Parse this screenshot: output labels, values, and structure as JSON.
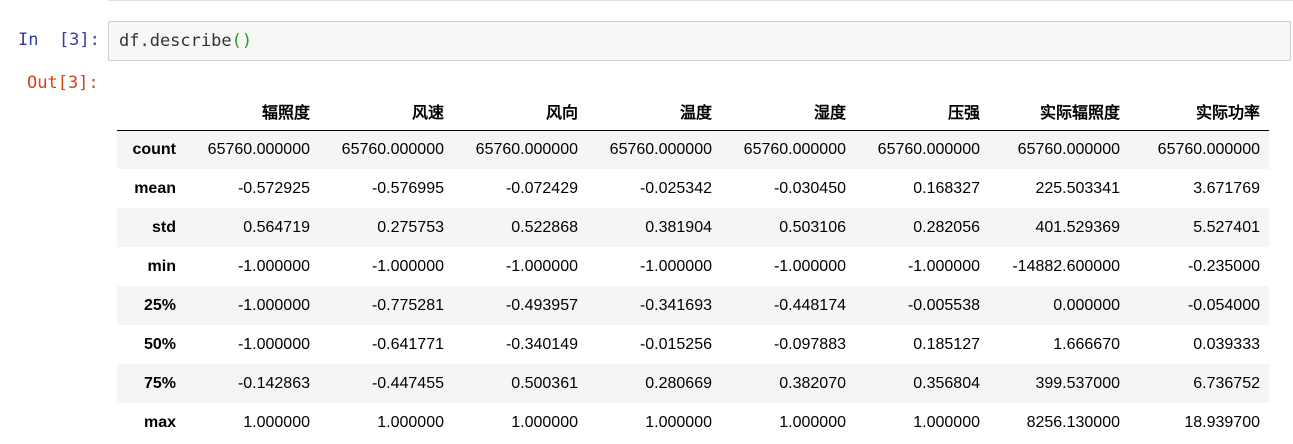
{
  "notebook": {
    "in_prompt": "In  [3]:",
    "out_prompt": "Out[3]:",
    "code": {
      "text": "df.describe",
      "open_paren": "(",
      "close_paren": ")"
    }
  },
  "table": {
    "columns": [
      "辐照度",
      "风速",
      "风向",
      "温度",
      "湿度",
      "压强",
      "实际辐照度",
      "实际功率"
    ],
    "rows": [
      {
        "label": "count",
        "values": [
          "65760.000000",
          "65760.000000",
          "65760.000000",
          "65760.000000",
          "65760.000000",
          "65760.000000",
          "65760.000000",
          "65760.000000"
        ]
      },
      {
        "label": "mean",
        "values": [
          "-0.572925",
          "-0.576995",
          "-0.072429",
          "-0.025342",
          "-0.030450",
          "0.168327",
          "225.503341",
          "3.671769"
        ]
      },
      {
        "label": "std",
        "values": [
          "0.564719",
          "0.275753",
          "0.522868",
          "0.381904",
          "0.503106",
          "0.282056",
          "401.529369",
          "5.527401"
        ]
      },
      {
        "label": "min",
        "values": [
          "-1.000000",
          "-1.000000",
          "-1.000000",
          "-1.000000",
          "-1.000000",
          "-1.000000",
          "-14882.600000",
          "-0.235000"
        ]
      },
      {
        "label": "25%",
        "values": [
          "-1.000000",
          "-0.775281",
          "-0.493957",
          "-0.341693",
          "-0.448174",
          "-0.005538",
          "0.000000",
          "-0.054000"
        ]
      },
      {
        "label": "50%",
        "values": [
          "-1.000000",
          "-0.641771",
          "-0.340149",
          "-0.015256",
          "-0.097883",
          "0.185127",
          "1.666670",
          "0.039333"
        ]
      },
      {
        "label": "75%",
        "values": [
          "-0.142863",
          "-0.447455",
          "0.500361",
          "0.280669",
          "0.382070",
          "0.356804",
          "399.537000",
          "6.736752"
        ]
      },
      {
        "label": "max",
        "values": [
          "1.000000",
          "1.000000",
          "1.000000",
          "1.000000",
          "1.000000",
          "1.000000",
          "8256.130000",
          "18.939700"
        ]
      }
    ]
  },
  "colors": {
    "in_prompt": "#303f9f",
    "out_prompt": "#d84315",
    "paren": "#22a222",
    "input_bg": "#f7f7f7",
    "row_stripe": "#f5f5f5"
  }
}
